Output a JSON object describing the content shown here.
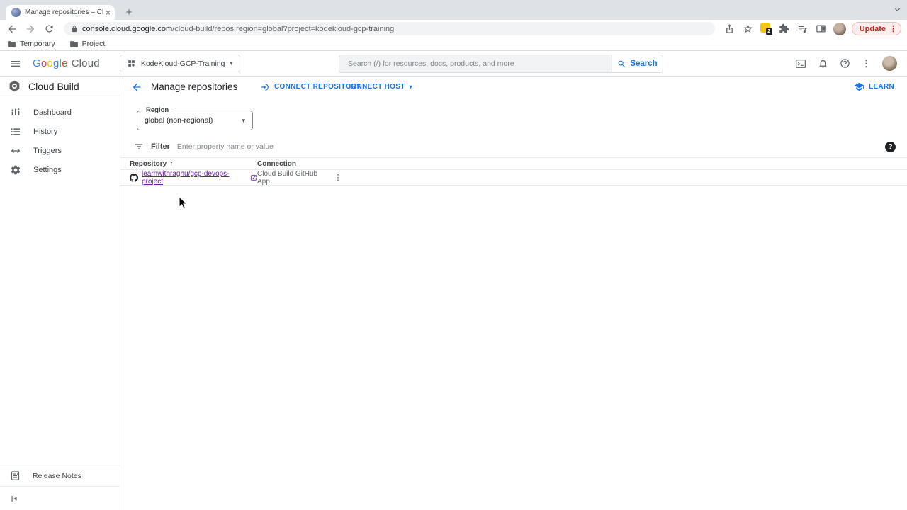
{
  "glyphs": {
    "close": "×",
    "plus": "+",
    "more_vert": "⋮",
    "dropdown": "▾",
    "sort_up": "↑",
    "question": "?"
  },
  "browser": {
    "tab_title": "Manage repositories – Cloud B",
    "url_domain": "console.cloud.google.com",
    "url_path": "/cloud-build/repos;region=global?project=kodekloud-gcp-training",
    "bookmarks": [
      "Temporary",
      "Project"
    ],
    "update_label": "Update",
    "extension_badge": "2"
  },
  "gcp_header": {
    "logo_letters": [
      "G",
      "o",
      "o",
      "g",
      "l",
      "e"
    ],
    "logo_cloud": "Cloud",
    "project_name": "KodeKloud-GCP-Training",
    "search_placeholder": "Search (/) for resources, docs, products, and more",
    "search_button": "Search"
  },
  "sidebar": {
    "product": "Cloud Build",
    "items": [
      "Dashboard",
      "History",
      "Triggers",
      "Settings"
    ],
    "release_notes": "Release Notes"
  },
  "page": {
    "title": "Manage repositories",
    "connect_repository": "CONNECT REPOSITORY",
    "connect_host": "CONNECT HOST",
    "learn": "LEARN",
    "region_label": "Region",
    "region_value": "global (non-regional)",
    "filter_label": "Filter",
    "filter_placeholder": "Enter property name or value",
    "table": {
      "columns": [
        "Repository",
        "Connection"
      ],
      "rows": [
        {
          "repository": "learnwithraghu/gcp-devops-project",
          "connection": "Cloud Build GitHub App"
        }
      ]
    }
  },
  "colors": {
    "accent_blue": "#1a73e8",
    "visited_link": "#681da8",
    "update_red": "#c5221f"
  }
}
